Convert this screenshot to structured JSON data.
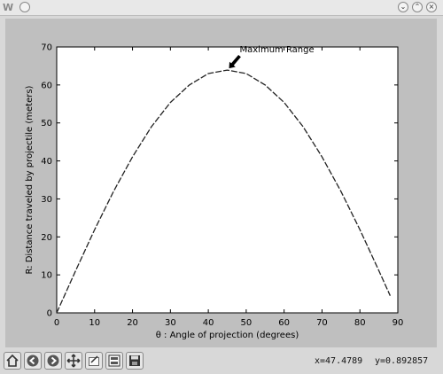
{
  "window": {
    "app_icon": "W",
    "controls": [
      "chevron-down-icon",
      "chevron-up-icon",
      "close-icon"
    ]
  },
  "toolbar": {
    "tools": [
      "home-icon",
      "back-icon",
      "forward-icon",
      "pan-icon",
      "zoom-icon",
      "subplots-icon",
      "save-icon"
    ],
    "x_readout": "x=47.4789",
    "y_readout": "y=0.892857"
  },
  "chart_data": {
    "type": "line",
    "title": "",
    "xlabel": "θ : Angle of projection (degrees)",
    "ylabel": "R: Distance traveled by projectile (meters)",
    "xlim": [
      0,
      90
    ],
    "ylim": [
      0,
      70
    ],
    "xticks": [
      "0",
      "10",
      "20",
      "30",
      "40",
      "50",
      "60",
      "70",
      "80",
      "90"
    ],
    "yticks": [
      "0",
      "10",
      "20",
      "30",
      "40",
      "50",
      "60",
      "70"
    ],
    "grid": false,
    "series": [
      {
        "line_style": "dashed",
        "color": "#222222",
        "x": [
          0,
          5,
          10,
          15,
          20,
          25,
          30,
          35,
          40,
          45,
          50,
          55,
          60,
          65,
          70,
          75,
          80,
          85,
          88
        ],
        "y": [
          0,
          11.1,
          21.9,
          32.0,
          41.1,
          49.0,
          55.4,
          60.0,
          63.0,
          63.9,
          63.0,
          60.0,
          55.4,
          49.0,
          41.1,
          32.0,
          21.9,
          11.1,
          4.5
        ]
      }
    ],
    "annotations": [
      {
        "text": "Maximum Range",
        "x": 45,
        "y": 63.9,
        "arrow": true
      }
    ]
  }
}
